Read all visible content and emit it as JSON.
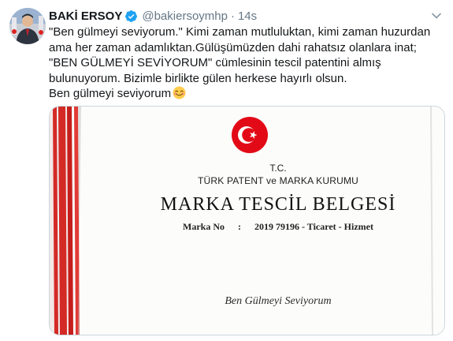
{
  "tweet": {
    "author": {
      "display_name": "BAKİ ERSOY",
      "handle": "@bakiersoymhp",
      "verified": true
    },
    "separator": "·",
    "timestamp": "14s",
    "text_lines": [
      "\"Ben gülmeyi seviyorum.\" Kimi zaman mutluluktan, kimi zaman huzurdan ama her zaman adamlıktan.Gülüşümüzden dahi rahatsız olanlara inat; \"BEN GÜLMEYİ SEVİYORUM\" cümlesinin tescil patentini almış bulunuyorum. Bizimle birlikte gülen herkese hayırlı olsun.",
      "Ben gülmeyi seviyorum"
    ],
    "emoji": "smiling-face-icon"
  },
  "certificate": {
    "country": "T.C.",
    "institution": "TÜRK PATENT ve MARKA KURUMU",
    "title": "MARKA TESCİL BELGESİ",
    "number_label": "Marka No",
    "number_sep": ":",
    "number": "2019 79196 - Ticaret - Hizmet",
    "mark_text": "Ben Gülmeyi Seviyorum"
  },
  "colors": {
    "text": "#14171a",
    "muted": "#657786",
    "verified": "#1da1f2",
    "border": "#ccd6dd",
    "ribbon_red": "#d42a26",
    "emblem_red": "#e30a17"
  }
}
